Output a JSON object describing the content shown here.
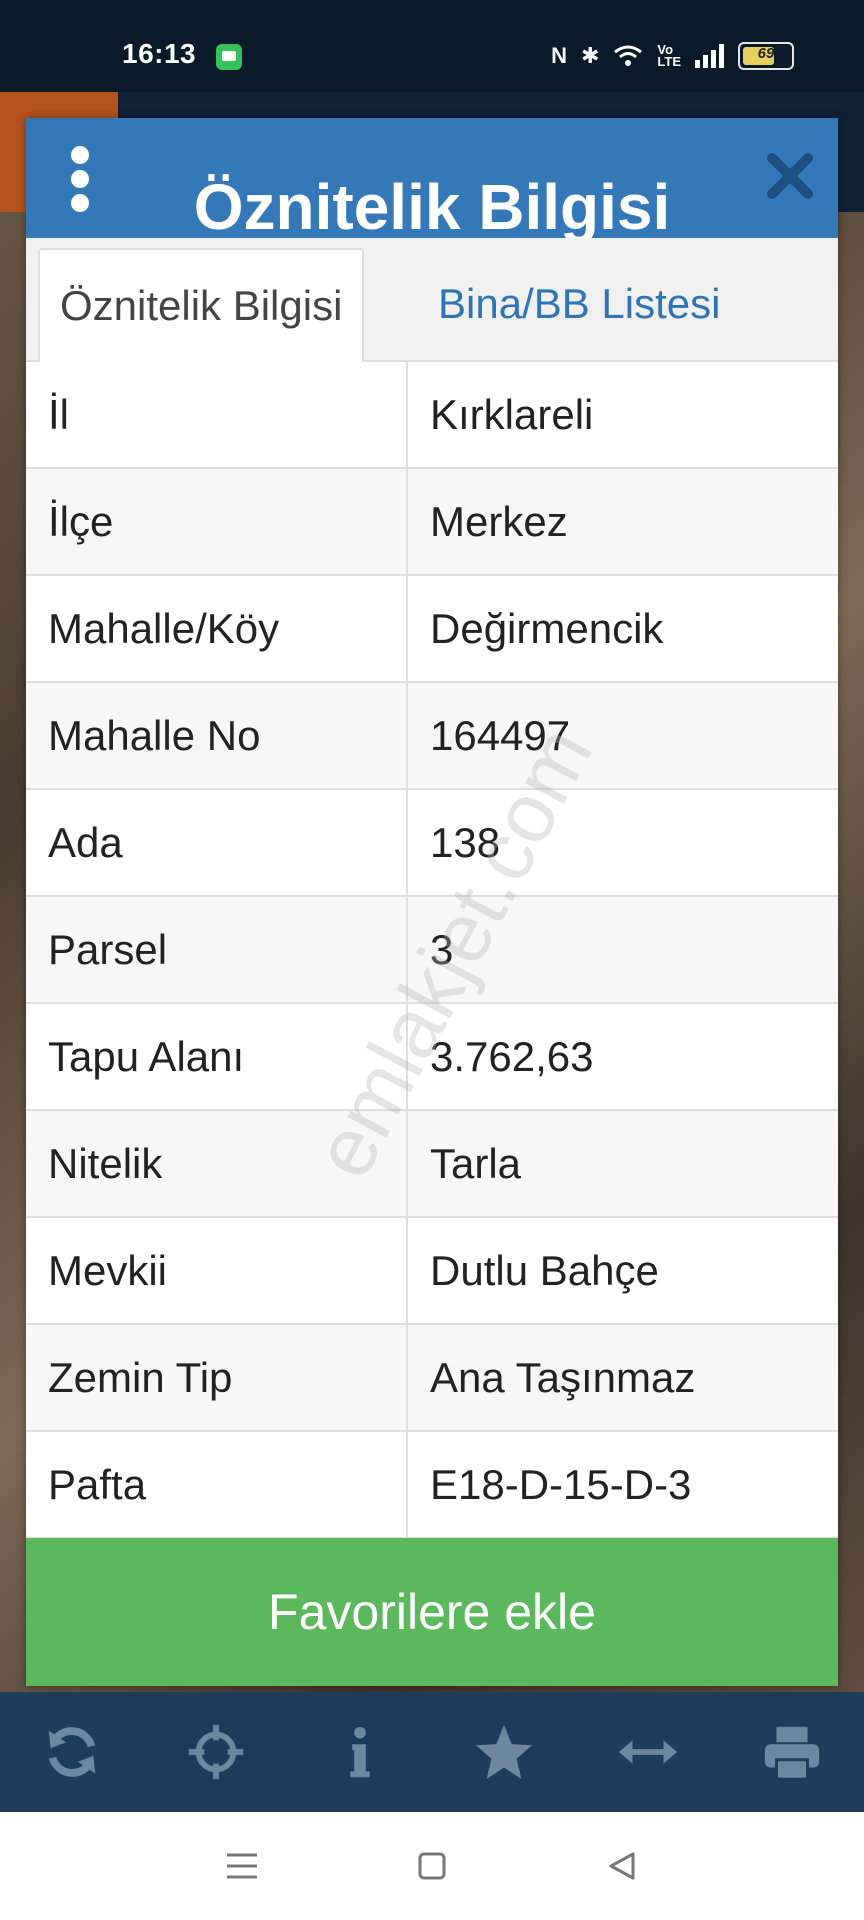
{
  "status_bar": {
    "time": "16:13",
    "battery": "69"
  },
  "dialog": {
    "title": "Öznitelik Bilgisi",
    "tabs": [
      {
        "label": "Öznitelik Bilgisi",
        "active": true
      },
      {
        "label": "Bina/BB Listesi",
        "active": false
      }
    ],
    "rows": [
      {
        "key": "İl",
        "value": "Kırklareli"
      },
      {
        "key": "İlçe",
        "value": "Merkez"
      },
      {
        "key": "Mahalle/Köy",
        "value": "Değirmencik"
      },
      {
        "key": "Mahalle No",
        "value": "164497"
      },
      {
        "key": "Ada",
        "value": "138"
      },
      {
        "key": "Parsel",
        "value": "3"
      },
      {
        "key": "Tapu Alanı",
        "value": "3.762,63"
      },
      {
        "key": "Nitelik",
        "value": "Tarla"
      },
      {
        "key": "Mevkii",
        "value": "Dutlu Bahçe"
      },
      {
        "key": "Zemin Tip",
        "value": "Ana Taşınmaz"
      },
      {
        "key": "Pafta",
        "value": "E18-D-15-D-3"
      }
    ],
    "favorite_button": "Favorilere ekle",
    "watermark": "emlakjet.com"
  },
  "toolbar": {
    "icons": [
      "refresh-icon",
      "crosshair-icon",
      "info-icon",
      "star-icon",
      "arrows-horizontal-icon",
      "print-icon"
    ]
  },
  "colors": {
    "header": "#3478b8",
    "tab_link": "#2f75b5",
    "favorite": "#5cb85c",
    "toolbar": "#1f3c5c",
    "toolbar_icon": "#6f86a0"
  }
}
